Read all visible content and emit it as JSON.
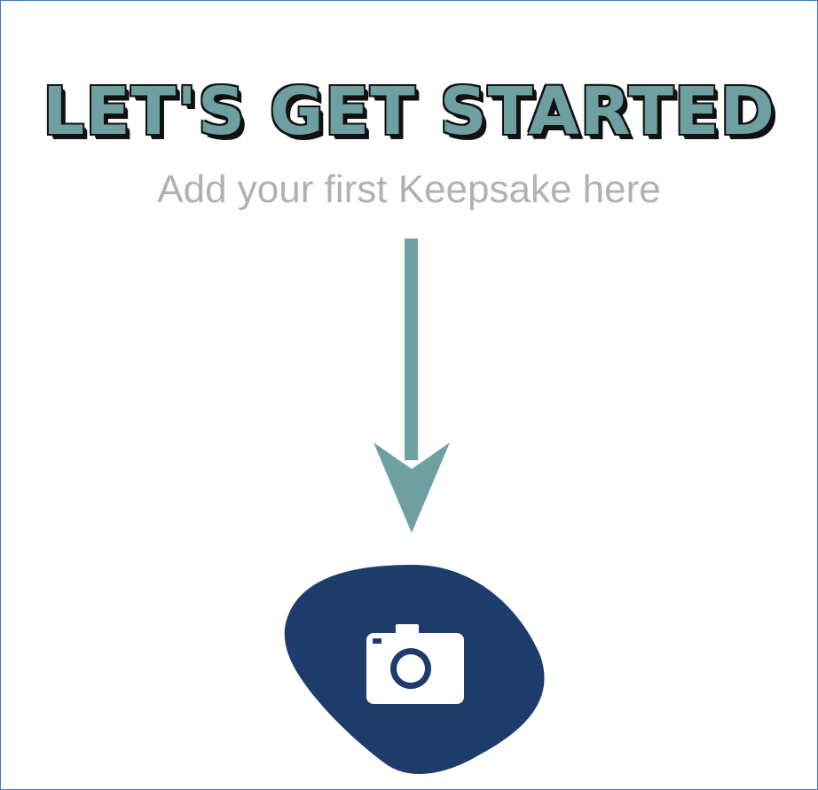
{
  "headline": "Let's Get Started",
  "subtitle": "Add your first Keepsake here",
  "upload_button": {
    "icon": "camera-icon"
  },
  "colors": {
    "accent": "#6fa0a1",
    "button": "#1e3c6b",
    "subtitle": "#b1b1b1",
    "frame_border": "#4a78c2"
  }
}
